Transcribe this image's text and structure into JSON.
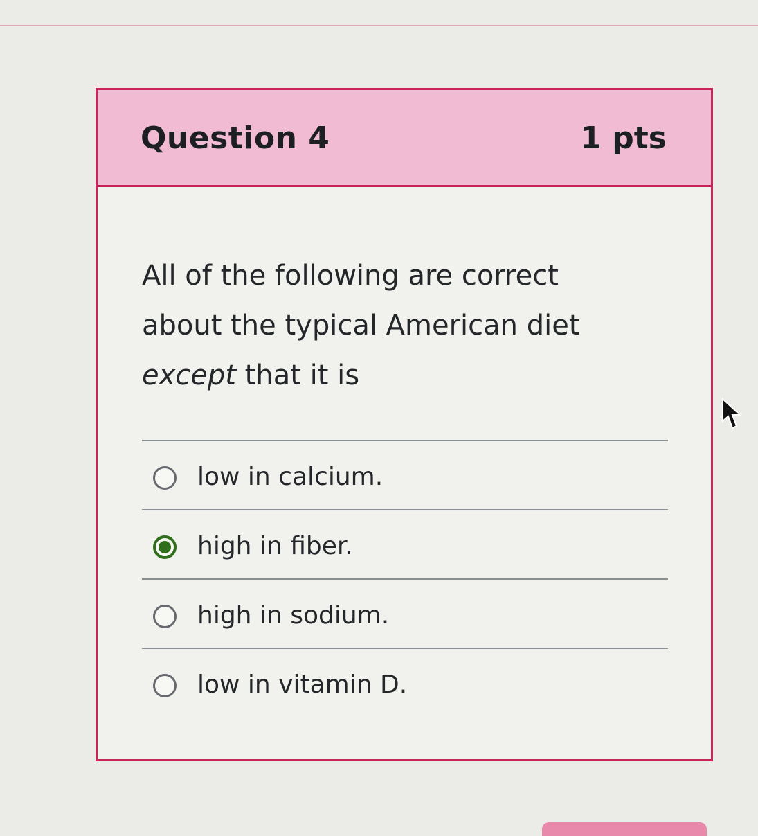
{
  "quiz": {
    "question_title": "Question 4",
    "points": "1 pts",
    "prompt": {
      "part1": "All of the following are correct about the typical American diet ",
      "emphasis": "except",
      "part2": " that it is"
    },
    "answers": [
      {
        "label": "low in calcium.",
        "selected": false
      },
      {
        "label": "high in fiber.",
        "selected": true
      },
      {
        "label": "high in sodium.",
        "selected": false
      },
      {
        "label": "low in vitamin D.",
        "selected": false
      }
    ]
  },
  "colors": {
    "accent": "#c8265a",
    "header_background": "#f1bcd3",
    "selected_radio": "#2f6e1b"
  },
  "icons": {
    "cursor": "mouse-pointer-icon"
  }
}
